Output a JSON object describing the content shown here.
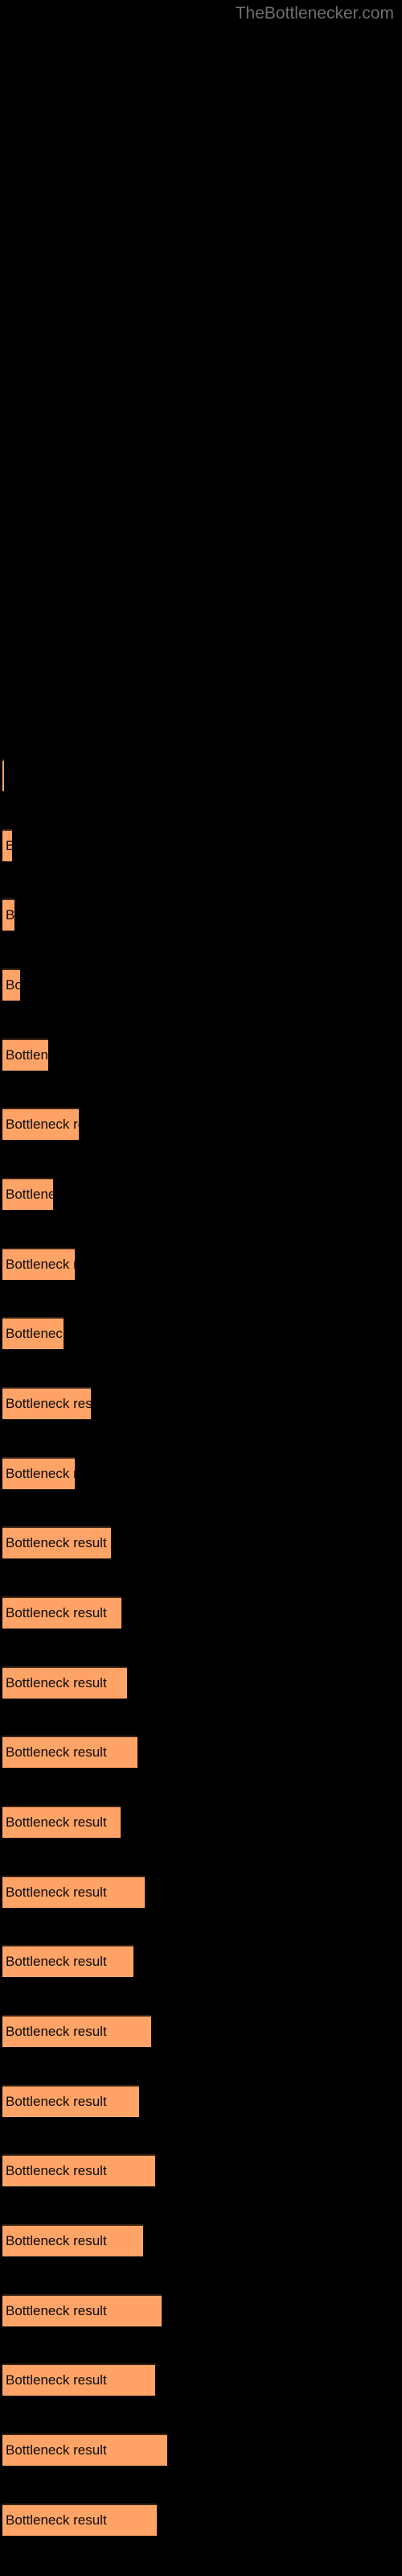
{
  "site": {
    "title": "TheBottlenecker.com",
    "title_color": "#6e6e6e"
  },
  "colors": {
    "background": "#000000",
    "bar_fill": "#ffa366",
    "bar_border": "#3a2316",
    "bar_text": "#0a0a0a"
  },
  "chart_data": {
    "type": "bar",
    "orientation": "horizontal",
    "title": "",
    "subtitle": "",
    "xlabel": "",
    "ylabel": "",
    "grid": false,
    "legend": null,
    "bar_label_text": "Bottleneck result",
    "categories": [
      "Bottleneck result",
      "Bottleneck result",
      "Bottleneck result",
      "Bottleneck result",
      "Bottleneck result",
      "Bottleneck result",
      "Bottleneck result",
      "Bottleneck result",
      "Bottleneck result",
      "Bottleneck result",
      "Bottleneck result",
      "Bottleneck result",
      "Bottleneck result",
      "Bottleneck result",
      "Bottleneck result",
      "Bottleneck result",
      "Bottleneck result",
      "Bottleneck result",
      "Bottleneck result",
      "Bottleneck result",
      "Bottleneck result",
      "Bottleneck result",
      "Bottleneck result",
      "Bottleneck result",
      "Bottleneck result",
      "Bottleneck result"
    ],
    "values": [
      2,
      12,
      15,
      22,
      57,
      95,
      63,
      90,
      76,
      110,
      90,
      135,
      148,
      155,
      168,
      147,
      177,
      163,
      185,
      170,
      190,
      175,
      198,
      190,
      205,
      192
    ],
    "xlim": [
      0,
      500
    ],
    "bar_tops": [
      943,
      1030,
      1116,
      1203,
      1290,
      1376,
      1463,
      1550,
      1636,
      1723,
      1810,
      1896,
      1983,
      2070,
      2156,
      2243,
      2330,
      2416,
      2503,
      2590,
      2676,
      2763,
      2850,
      2936,
      3023,
      3110
    ]
  }
}
